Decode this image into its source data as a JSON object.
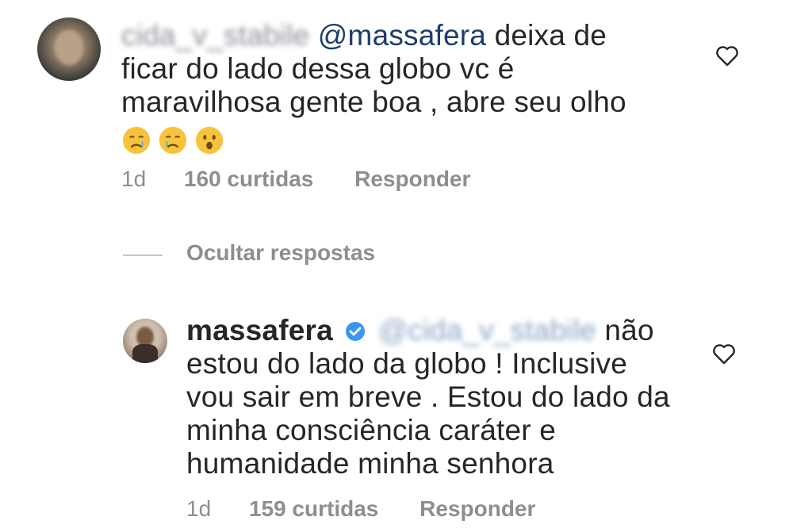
{
  "comments": [
    {
      "username": "cida_v_stabile",
      "mention": "@massafera",
      "text_lines": [
        "deixa de",
        "ficar do lado dessa globo vc é",
        "maravilhosa gente boa , abre seu olho"
      ],
      "emojis": [
        "crying-face",
        "crying-face",
        "astonished-face"
      ],
      "time": "1d",
      "likes": "160 curtidas",
      "reply_label": "Responder"
    },
    {
      "username": "massafera",
      "mention": "@cida_v_stabile",
      "text_lines": [
        "não",
        "estou do lado da globo ! Inclusive",
        "vou sair em breve . Estou do lado da",
        "minha consciência caráter e",
        "humanidade minha senhora"
      ],
      "time": "1d",
      "likes": "159 curtidas",
      "reply_label": "Responder"
    }
  ],
  "hide_replies_label": "Ocultar respostas",
  "colors": {
    "text": "#262626",
    "muted": "#8e8e8e",
    "mention": "#1c3d6e",
    "verified": "#3897f0"
  }
}
